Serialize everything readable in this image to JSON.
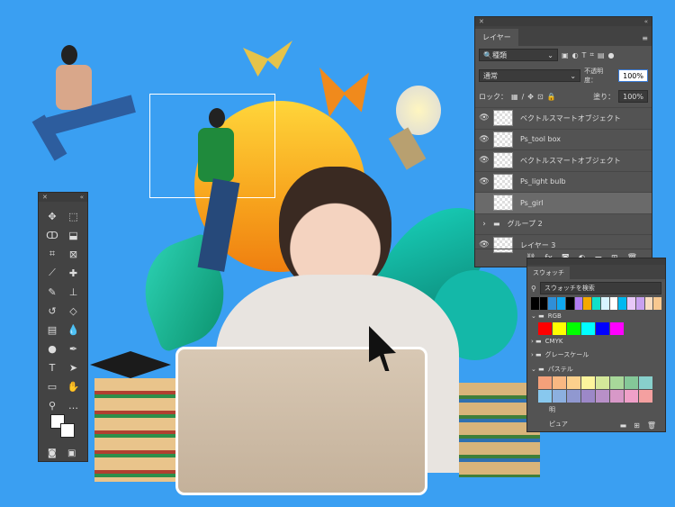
{
  "layers_panel": {
    "tab": "レイヤー",
    "filter": "種類",
    "blend_mode": "通常",
    "opacity_label": "不透明度：",
    "opacity": "100%",
    "lock_label": "ロック：",
    "fill_label": "塗り：",
    "fill": "100%",
    "layers": [
      {
        "name": "ベクトルスマートオブジェクト",
        "visible": true
      },
      {
        "name": "Ps_tool box",
        "visible": true
      },
      {
        "name": "ベクトルスマートオブジェクト",
        "visible": true
      },
      {
        "name": "Ps_light bulb",
        "visible": true
      },
      {
        "name": "Ps_girl",
        "visible": false,
        "active": true
      },
      {
        "name": "グループ 2",
        "group": true
      },
      {
        "name": "レイヤー 3",
        "visible": true
      }
    ]
  },
  "swatches_panel": {
    "tab": "スウォッチ",
    "search": "スウォッチを検索",
    "recent": [
      "#000000",
      "#000000",
      "#2f8fd8",
      "#10a8f0",
      "#000000",
      "#b07cf0",
      "#f5a800",
      "#10e0c8",
      "#d8f4ff",
      "#ffffff",
      "#00b8f0",
      "#e8c8f8",
      "#c8a0f0",
      "#f8dcc0",
      "#f8c890"
    ],
    "groups": [
      {
        "name": "RGB",
        "open": true,
        "colors": [
          "#ff0000",
          "#ffff00",
          "#00ff00",
          "#00ffff",
          "#0000ff",
          "#ff00ff"
        ]
      },
      {
        "name": "CMYK",
        "open": false
      },
      {
        "name": "グレースケール",
        "open": false
      },
      {
        "name": "パステル",
        "open": true,
        "colors": [
          "#f4a07a",
          "#f8b882",
          "#fbd08c",
          "#fdf59c",
          "#d4e89a",
          "#a8d89a",
          "#84c898",
          "#88d0cc",
          "#88c8ee",
          "#8cb0e0",
          "#9098d0",
          "#9c88c8",
          "#b890c8",
          "#d898c8",
          "#f0a0c8",
          "#f4a0a0"
        ]
      },
      {
        "name": "明"
      },
      {
        "name": "ピュア"
      }
    ]
  },
  "colors": {
    "background": "#3a9ff2",
    "panel": "#535353"
  }
}
